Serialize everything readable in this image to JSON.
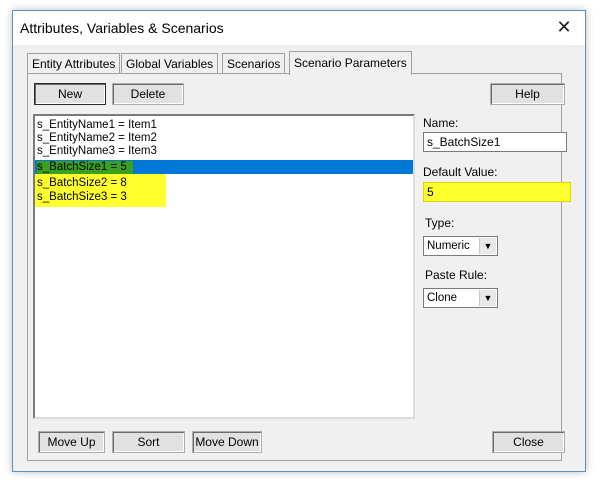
{
  "window": {
    "title": "Attributes, Variables & Scenarios",
    "close_glyph": "✕"
  },
  "tabs": [
    {
      "label": "Entity Attributes"
    },
    {
      "label": "Global Variables"
    },
    {
      "label": "Scenarios"
    },
    {
      "label": "Scenario Parameters",
      "active": true
    }
  ],
  "toolbar": {
    "new_label": "New",
    "delete_label": "Delete",
    "help_label": "Help"
  },
  "list": {
    "items": [
      {
        "text": "s_EntityName1 = Item1",
        "state": "normal"
      },
      {
        "text": "s_EntityName2 = Item2",
        "state": "normal"
      },
      {
        "text": "s_EntityName3 = Item3",
        "state": "normal"
      },
      {
        "text": "s_BatchSize1 = 5",
        "state": "selected-highlighted"
      },
      {
        "text": "s_BatchSize2 = 8",
        "state": "highlighted"
      },
      {
        "text": "s_BatchSize3 = 3",
        "state": "highlighted"
      }
    ]
  },
  "details": {
    "name_label": "Name:",
    "name_value": "s_BatchSize1",
    "default_label": "Default Value:",
    "default_value": "5",
    "type_label": "Type:",
    "type_value": "Numeric",
    "paste_label": "Paste Rule:",
    "paste_value": "Clone"
  },
  "bottom": {
    "move_up_label": "Move Up",
    "sort_label": "Sort",
    "move_down_label": "Move Down",
    "close_label": "Close"
  },
  "colors": {
    "selection_blue": "#0078d7",
    "highlight_yellow": "#ffff2e",
    "highlight_green": "#3aa020"
  }
}
